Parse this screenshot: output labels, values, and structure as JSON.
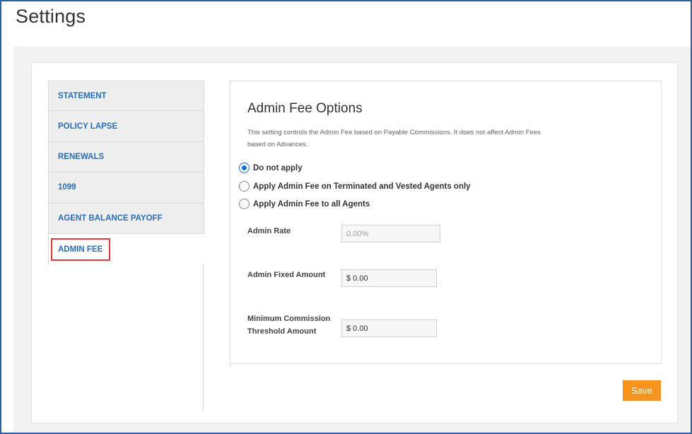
{
  "page": {
    "title": "Settings"
  },
  "nav": {
    "items": [
      {
        "label": "STATEMENT"
      },
      {
        "label": "POLICY LAPSE"
      },
      {
        "label": "RENEWALS"
      },
      {
        "label": "1099"
      },
      {
        "label": "AGENT BALANCE PAYOFF"
      },
      {
        "label": "ADMIN FEE",
        "active": true
      }
    ]
  },
  "panel": {
    "title": "Admin Fee Options",
    "description": "This setting controls the Admin Fee based on Payable Commissions. It does not affect Admin Fees based on Advances.",
    "options": [
      {
        "label": "Do not apply",
        "selected": true
      },
      {
        "label": "Apply Admin Fee on Terminated and Vested Agents only",
        "selected": false
      },
      {
        "label": "Apply Admin Fee to all Agents",
        "selected": false
      }
    ],
    "fields": {
      "admin_rate": {
        "label": "Admin Rate",
        "value": "",
        "placeholder": "0.00%"
      },
      "admin_fixed_amount": {
        "label": "Admin Fixed Amount",
        "value": "$ 0.00"
      },
      "minimum_commission_line1": "Minimum Commission",
      "minimum_commission_line2": "Threshold Amount",
      "minimum_commission_value": "$ 0.00"
    }
  },
  "actions": {
    "save_label": "Save"
  },
  "colors": {
    "link": "#2a6db5",
    "accent": "#f7941d",
    "highlight": "#e0393e",
    "frame": "#2f5fa0"
  }
}
